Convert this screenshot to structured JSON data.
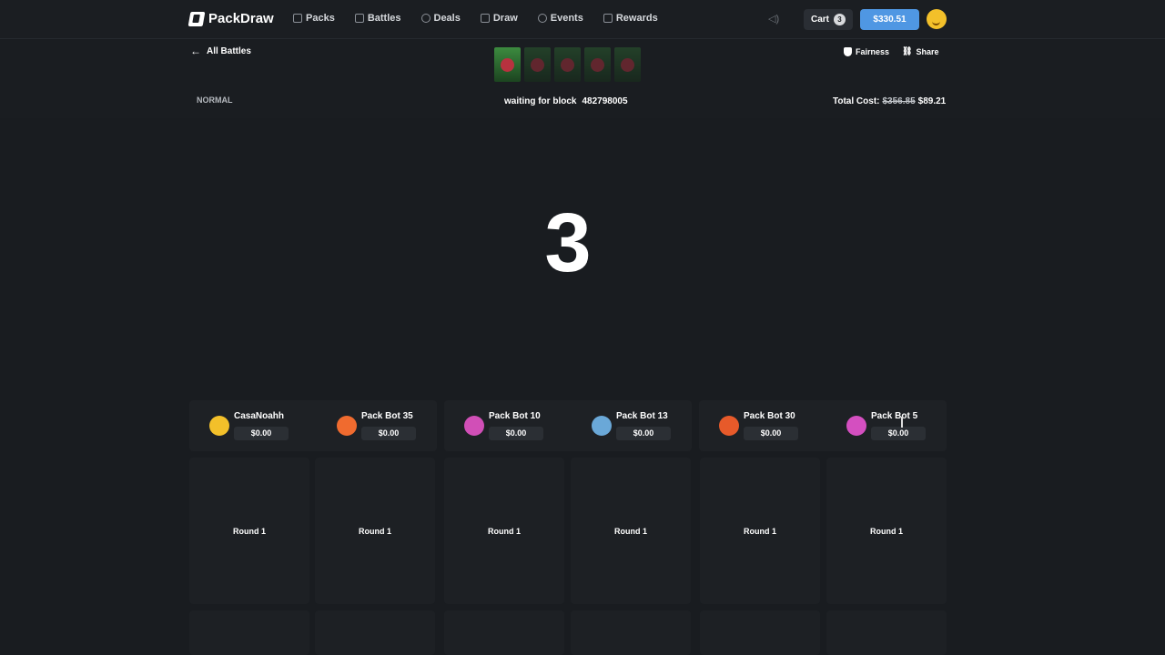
{
  "nav": {
    "logo": "PackDraw",
    "items": [
      "Packs",
      "Battles",
      "Deals",
      "Draw",
      "Events",
      "Rewards"
    ],
    "cart_label": "Cart",
    "cart_count": "3",
    "balance": "$330.51"
  },
  "battle": {
    "back_label": "All Battles",
    "mode": "NORMAL",
    "status": "waiting for block",
    "block_number": "482798005",
    "fairness_label": "Fairness",
    "share_label": "Share",
    "total_cost_label": "Total Cost:",
    "old_cost": "$356.85",
    "cost": "$89.21",
    "countdown": "3"
  },
  "players": [
    {
      "name": "CasaNoahh",
      "value": "$0.00",
      "color": "#f3c02a"
    },
    {
      "name": "Pack Bot 35",
      "value": "$0.00",
      "color": "#f06b2f"
    },
    {
      "name": "Pack Bot 10",
      "value": "$0.00",
      "color": "#d14fb7"
    },
    {
      "name": "Pack Bot 13",
      "value": "$0.00",
      "color": "#6aa8d8"
    },
    {
      "name": "Pack Bot 30",
      "value": "$0.00",
      "color": "#e75a2a"
    },
    {
      "name": "Pack Bot 5",
      "value": "$0.00",
      "color": "#d44fc0"
    }
  ],
  "rounds": [
    "Round 1",
    "Round 1",
    "Round 1",
    "Round 1",
    "Round 1",
    "Round 1"
  ]
}
